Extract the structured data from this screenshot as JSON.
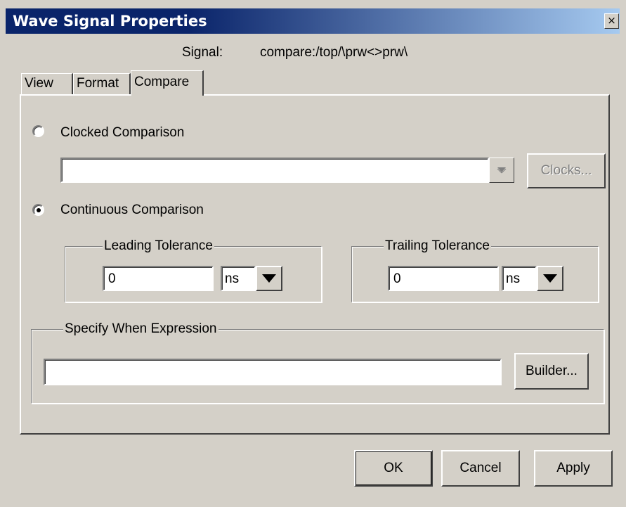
{
  "window": {
    "title": "Wave Signal Properties",
    "close_glyph": "×"
  },
  "signal": {
    "label": "Signal:",
    "value": "compare:/top/\\prw<>prw\\"
  },
  "tabs": [
    {
      "label": "View",
      "active": false
    },
    {
      "label": "Format",
      "active": false
    },
    {
      "label": "Compare",
      "active": true
    }
  ],
  "compare": {
    "clocked": {
      "label": "Clocked Comparison",
      "selected": false,
      "clock_value": "",
      "clocks_button": "Clocks...",
      "clocks_enabled": false
    },
    "continuous": {
      "label": "Continuous Comparison",
      "selected": true,
      "leading": {
        "title": "Leading Tolerance",
        "value": "0",
        "unit": "ns"
      },
      "trailing": {
        "title": "Trailing Tolerance",
        "value": "0",
        "unit": "ns"
      }
    },
    "when_expression": {
      "title": "Specify When Expression",
      "value": "",
      "builder_button": "Builder..."
    }
  },
  "buttons": {
    "ok": "OK",
    "cancel": "Cancel",
    "apply": "Apply"
  },
  "colors": {
    "face": "#d4d0c8",
    "title_start": "#0a246a",
    "title_end": "#a6caf0"
  }
}
